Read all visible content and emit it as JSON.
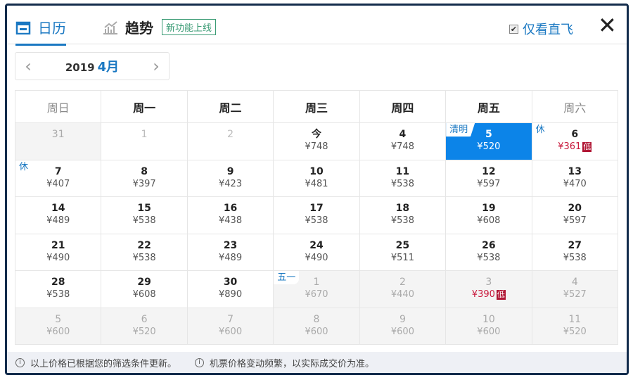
{
  "tabs": [
    {
      "label": "日历",
      "icon": "calendar-icon"
    },
    {
      "label": "趋势",
      "icon": "chart-icon",
      "badge": "新功能上线"
    }
  ],
  "direct_only": {
    "label": "仅看直飞",
    "checked": true
  },
  "month_nav": {
    "year": "2019",
    "month": "4月"
  },
  "weekdays": [
    "周日",
    "周一",
    "周二",
    "周三",
    "周四",
    "周五",
    "周六"
  ],
  "low_label": "低",
  "weeks": [
    [
      {
        "d": "31",
        "out": true
      },
      {
        "d": "1",
        "dis": true
      },
      {
        "d": "2",
        "dis": true
      },
      {
        "d": "今",
        "p": "¥748"
      },
      {
        "d": "4",
        "p": "¥748"
      },
      {
        "d": "5",
        "p": "¥520",
        "sel": true,
        "tag": "清明"
      },
      {
        "d": "6",
        "p": "¥361",
        "low": true,
        "tag": "休"
      }
    ],
    [
      {
        "d": "7",
        "p": "¥407",
        "tag": "休"
      },
      {
        "d": "8",
        "p": "¥397"
      },
      {
        "d": "9",
        "p": "¥423"
      },
      {
        "d": "10",
        "p": "¥481"
      },
      {
        "d": "11",
        "p": "¥538"
      },
      {
        "d": "12",
        "p": "¥597"
      },
      {
        "d": "13",
        "p": "¥470"
      }
    ],
    [
      {
        "d": "14",
        "p": "¥489"
      },
      {
        "d": "15",
        "p": "¥538"
      },
      {
        "d": "16",
        "p": "¥438"
      },
      {
        "d": "17",
        "p": "¥538"
      },
      {
        "d": "18",
        "p": "¥538"
      },
      {
        "d": "19",
        "p": "¥608"
      },
      {
        "d": "20",
        "p": "¥597"
      }
    ],
    [
      {
        "d": "21",
        "p": "¥490"
      },
      {
        "d": "22",
        "p": "¥538"
      },
      {
        "d": "23",
        "p": "¥489"
      },
      {
        "d": "24",
        "p": "¥490"
      },
      {
        "d": "25",
        "p": "¥511"
      },
      {
        "d": "26",
        "p": "¥538"
      },
      {
        "d": "27",
        "p": "¥538"
      }
    ],
    [
      {
        "d": "28",
        "p": "¥538"
      },
      {
        "d": "29",
        "p": "¥608"
      },
      {
        "d": "30",
        "p": "¥890"
      },
      {
        "d": "1",
        "p": "¥670",
        "out": true,
        "tag": "五一"
      },
      {
        "d": "2",
        "p": "¥440",
        "out": true
      },
      {
        "d": "3",
        "p": "¥390",
        "out": true,
        "low": true
      },
      {
        "d": "4",
        "p": "¥527",
        "out": true
      }
    ],
    [
      {
        "d": "5",
        "p": "¥600",
        "out": true
      },
      {
        "d": "6",
        "p": "¥520",
        "out": true
      },
      {
        "d": "7",
        "p": "¥600",
        "out": true
      },
      {
        "d": "8",
        "p": "¥600",
        "out": true
      },
      {
        "d": "9",
        "p": "¥600",
        "out": true
      },
      {
        "d": "10",
        "p": "¥600",
        "out": true
      },
      {
        "d": "11",
        "p": "¥520",
        "out": true
      }
    ]
  ],
  "footer_notes": [
    "以上价格已根据您的筛选条件更新。",
    "机票价格变动频繁，以实际成交价为准。"
  ]
}
